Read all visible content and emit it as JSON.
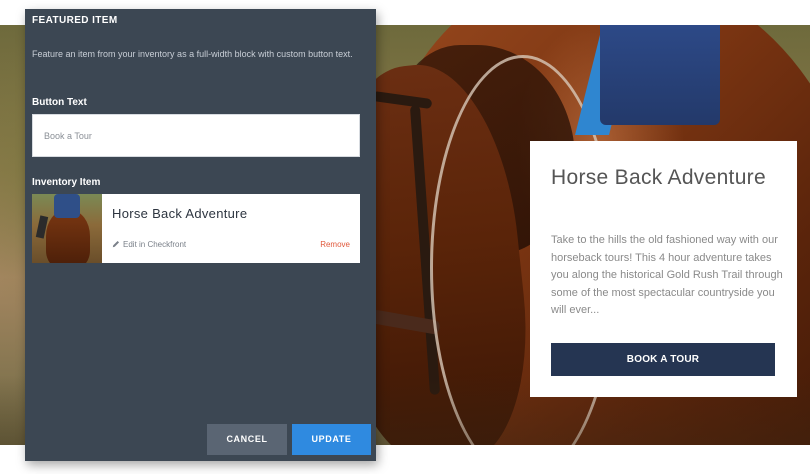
{
  "panel": {
    "title": "FEATURED ITEM",
    "description": "Feature an item from your inventory as a full-width block with custom button text.",
    "button_text_label": "Button Text",
    "button_text_value": "Book a Tour",
    "inventory_label": "Inventory Item",
    "inventory_item": {
      "title": "Horse Back Adventure",
      "edit_link": "Edit in Checkfront",
      "remove_link": "Remove"
    },
    "cancel_label": "CANCEL",
    "update_label": "UPDATE"
  },
  "hero_card": {
    "title": "Horse Back Adventure",
    "description": "Take to the hills the old fashioned way with our horseback tours! This 4 hour adventure takes you along the historical Gold Rush Trail through some of the most spectacular countryside you will ever...",
    "button_label": "BOOK A TOUR"
  },
  "icons": {
    "edit": "pencil-icon"
  },
  "colors": {
    "panel_bg": "#3c4753",
    "update_button": "#2f8ae0",
    "cancel_button": "#5a6573",
    "hero_button": "#253552",
    "remove_link": "#e0583b"
  }
}
